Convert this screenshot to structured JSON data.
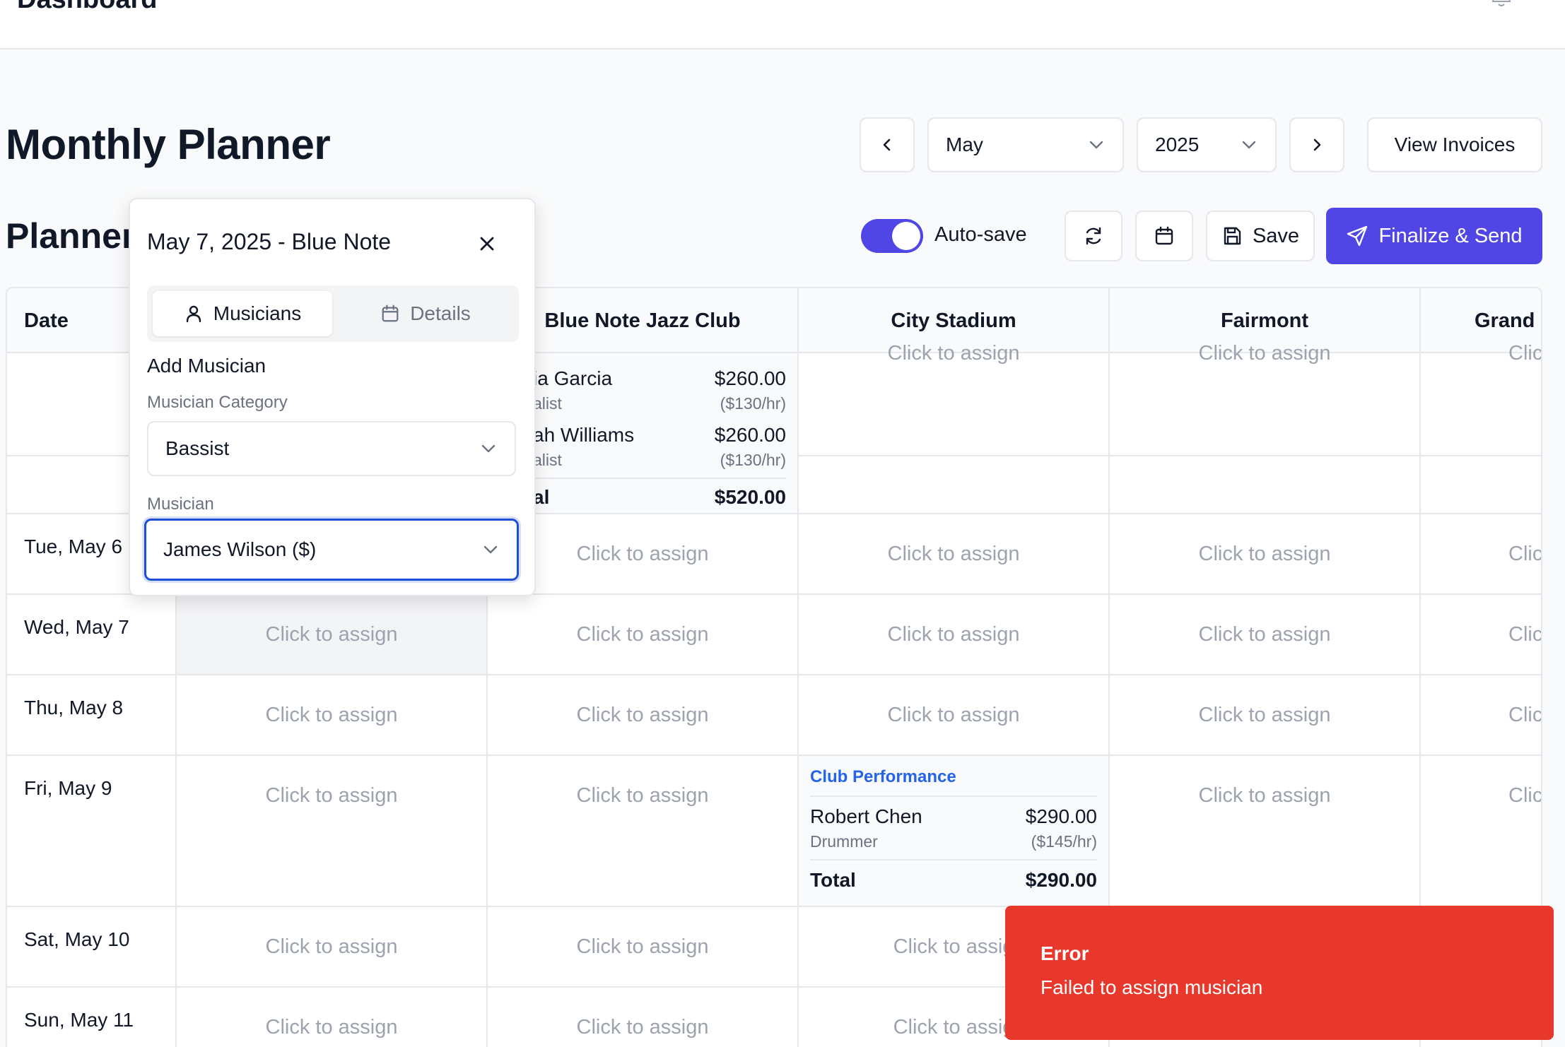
{
  "header": {
    "title": "Dashboard",
    "bell_icon": "bell-icon"
  },
  "page": {
    "title": "Monthly Planner"
  },
  "toolbar": {
    "month": "May",
    "year": "2025",
    "view_invoices": "View Invoices",
    "autosave_label": "Auto-save",
    "autosave_on": true,
    "save": "Save",
    "finalize": "Finalize & Send",
    "accent_color": "#4f46e5"
  },
  "planner": {
    "title": "Planner",
    "columns": [
      "Date",
      "Blue Note Jazz Club",
      "City Stadium",
      "Fairmont",
      "Grand E"
    ],
    "assign_text": "Click to assign",
    "assign_partial": "Clic",
    "assign_cut": "Click to assig",
    "rows": [
      {
        "date": "Tue, May 6"
      },
      {
        "date": "Wed, May 7"
      },
      {
        "date": "Thu, May 8"
      },
      {
        "date": "Fri, May 9"
      },
      {
        "date": "Sat, May 10"
      },
      {
        "date": "Sun, May 11"
      }
    ],
    "booking_top": {
      "m1_name": "ia Garcia",
      "m1_role": "alist",
      "m1_amount": "$260.00",
      "m1_rate": "($130/hr)",
      "m2_name": "ah Williams",
      "m2_role": "alist",
      "m2_amount": "$260.00",
      "m2_rate": "($130/hr)",
      "total_label": "al",
      "total_value": "$520.00"
    },
    "booking_fri": {
      "title": "Club Performance",
      "name": "Robert Chen",
      "role": "Drummer",
      "amount": "$290.00",
      "rate": "($145/hr)",
      "total_label": "Total",
      "total_value": "$290.00"
    }
  },
  "popover": {
    "title": "May 7, 2025 - Blue Note",
    "tab_musicians": "Musicians",
    "tab_details": "Details",
    "add_label": "Add Musician",
    "category_label": "Musician Category",
    "category_value": "Bassist",
    "musician_label": "Musician",
    "musician_value": "James Wilson ($)"
  },
  "toast": {
    "title": "Error",
    "message": "Failed to assign musician",
    "color": "#e8372b"
  }
}
